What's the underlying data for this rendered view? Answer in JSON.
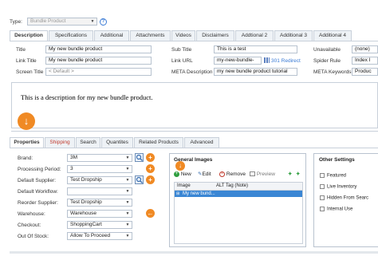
{
  "top": {
    "type_label": "Type:",
    "type_value": "Bundle Product"
  },
  "tabs": [
    {
      "label": "Description"
    },
    {
      "label": "Specifications"
    },
    {
      "label": "Additional"
    },
    {
      "label": "Attachments"
    },
    {
      "label": "Videos"
    },
    {
      "label": "Disclaimers"
    },
    {
      "label": "Addtional 2"
    },
    {
      "label": "Additional 3"
    },
    {
      "label": "Additional 4"
    }
  ],
  "fields": {
    "title_label": "Title",
    "title_value": "My new bundle product",
    "subtitle_label": "Sub Title",
    "subtitle_value": "This is a test",
    "unavailable_label": "Unavailable",
    "unavailable_value": "(none)",
    "linktitle_label": "Link Title",
    "linktitle_value": "My new bundle product",
    "linkurl_label": "Link URL",
    "linkurl_value": "my-new-bundle-",
    "redirect_label": "301 Redirect",
    "spider_label": "Spider Rule",
    "spider_value": "Index I",
    "screentitle_label": "Screen Title",
    "screentitle_placeholder": "< Default >",
    "meta_desc_label": "META Description",
    "meta_desc_value": "my new bundle product tutorial",
    "meta_kw_label": "META Keywords",
    "meta_kw_value": "Produc"
  },
  "description_text": "This is a description for my new bundle product.",
  "bottom_tabs": [
    {
      "label": "Properties"
    },
    {
      "label": "Shipping"
    },
    {
      "label": "Search"
    },
    {
      "label": "Quantites"
    },
    {
      "label": "Related Products"
    },
    {
      "label": "Advanced"
    }
  ],
  "properties": [
    {
      "label": "Brand:",
      "value": "3M"
    },
    {
      "label": "Processing Period:",
      "value": "3"
    },
    {
      "label": "Default Supplier:",
      "value": "Test Dropship"
    },
    {
      "label": "Default Workflow:",
      "value": ""
    },
    {
      "label": "Reorder Supplier:",
      "value": "Test Dropship"
    },
    {
      "label": "Warehouse:",
      "value": "Warehouse"
    },
    {
      "label": "Checkout:",
      "value": "ShoppingCart"
    },
    {
      "label": "Out Of Stock:",
      "value": "Allow To Proceed"
    }
  ],
  "images": {
    "title": "General Images",
    "new_label": "New",
    "edit_label": "Edit",
    "remove_label": "Remove",
    "preview_label": "Preview",
    "col_image": "Image",
    "col_alt": "ALT Tag (Note)",
    "row_name": "My new bund..."
  },
  "other": {
    "title": "Other Settings",
    "items": [
      "Featured",
      "Live Inventory",
      "Hidden From Searc",
      "Internal Use"
    ]
  },
  "colors": {
    "accent_orange": "#f08a24",
    "selected_row": "#3a86d4",
    "link_blue": "#3a7bd5"
  }
}
